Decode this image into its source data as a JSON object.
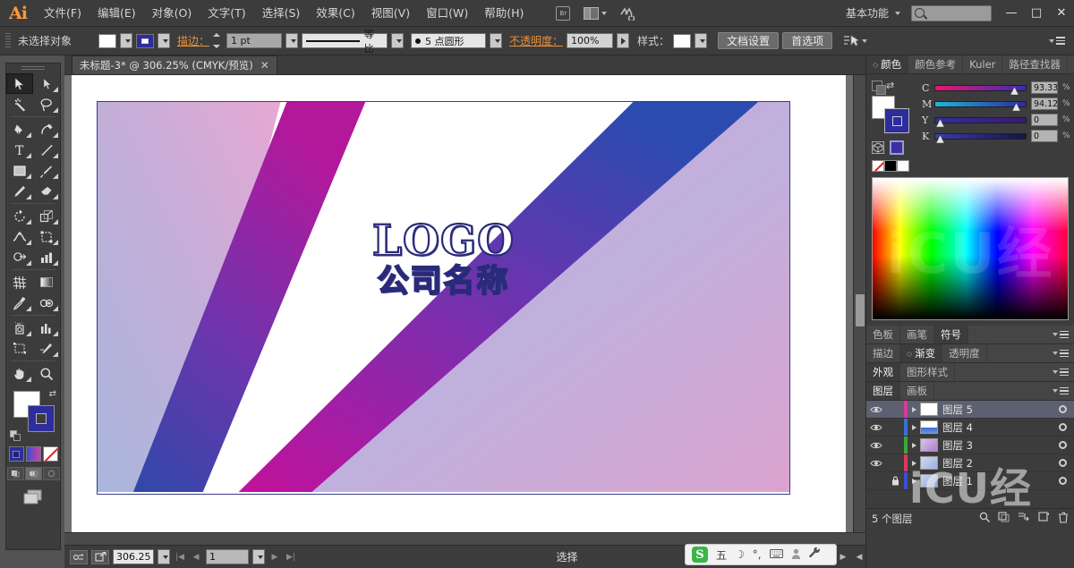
{
  "app": {
    "name": "Ai",
    "logo_color": "#ff9a3c"
  },
  "menubar": {
    "items": [
      {
        "label": "文件(F)"
      },
      {
        "label": "编辑(E)"
      },
      {
        "label": "对象(O)"
      },
      {
        "label": "文字(T)"
      },
      {
        "label": "选择(S)"
      },
      {
        "label": "效果(C)"
      },
      {
        "label": "视图(V)"
      },
      {
        "label": "窗口(W)"
      },
      {
        "label": "帮助(H)"
      }
    ],
    "bridge_label": "Br",
    "workspace": "基本功能",
    "search_placeholder": "",
    "window_buttons": {
      "minimize": "—",
      "maximize": "□",
      "close": "✕"
    }
  },
  "controlbar": {
    "selection_status": "未选择对象",
    "stroke_label": "描边：",
    "stroke_weight": "1 pt",
    "profile_label": "等比",
    "brush_label": "5 点圆形",
    "opacity_label": "不透明度：",
    "opacity_value": "100%",
    "style_label": "样式：",
    "doc_setup_button": "文档设置",
    "preferences_button": "首选项"
  },
  "document": {
    "tab_title": "未标题-3* @ 306.25% (CMYK/预览)",
    "close_label": "✕"
  },
  "artwork": {
    "logo_text": "LOGO",
    "company_text": "公司名称",
    "logo_color": "#2a2a7a",
    "border_color": "#3a3a8a",
    "gradient_light_start": "#a9b6dd",
    "gradient_light_end": "#e7a8d4",
    "stripe_top": "#b3189b",
    "stripe_bottom": "#2f49a8",
    "stripe_right_top": "#2b4bb0",
    "stripe_right_bottom": "#c2119b"
  },
  "statusbar": {
    "zoom_level": "306.25",
    "artboard_number": "1",
    "status_text": "选择"
  },
  "color_panel": {
    "tabs": [
      {
        "label": "颜色",
        "active": true
      },
      {
        "label": "颜色参考",
        "active": false
      },
      {
        "label": "Kuler",
        "active": false
      },
      {
        "label": "路径查找器",
        "active": false
      }
    ],
    "channels": [
      {
        "label": "C",
        "value": "93.33",
        "unit": "%",
        "pos": 83,
        "track": "linear-gradient(90deg,#e8186e,#3a2bb8)"
      },
      {
        "label": "M",
        "value": "94.12",
        "unit": "%",
        "pos": 85,
        "track": "linear-gradient(90deg,#1fb5d8,#2b2b9e)"
      },
      {
        "label": "Y",
        "value": "0",
        "unit": "%",
        "pos": 2,
        "track": "linear-gradient(90deg,#2f2f9e,#3a1a6e)"
      },
      {
        "label": "K",
        "value": "0",
        "unit": "%",
        "pos": 2,
        "track": "linear-gradient(90deg,#3b3bb0,#151540)"
      }
    ],
    "spectrum_watermark": "iCU经"
  },
  "dock_tab_rows": [
    {
      "tabs": [
        {
          "label": "色板",
          "active": false
        },
        {
          "label": "画笔",
          "active": false
        },
        {
          "label": "符号",
          "active": true
        }
      ]
    },
    {
      "tabs": [
        {
          "label": "描边",
          "active": false
        },
        {
          "label": "渐变",
          "active": true
        },
        {
          "label": "透明度",
          "active": false
        }
      ]
    },
    {
      "tabs": [
        {
          "label": "外观",
          "active": true
        },
        {
          "label": "图形样式",
          "active": false
        }
      ]
    },
    {
      "tabs": [
        {
          "label": "图层",
          "active": true
        },
        {
          "label": "画板",
          "active": false
        }
      ]
    }
  ],
  "layers_panel": {
    "rows": [
      {
        "name": "图层 5",
        "color": "#e0359c",
        "visible": true,
        "locked": false,
        "selected": true,
        "thumb": "#ffffff"
      },
      {
        "name": "图层 4",
        "color": "#3b6fd4",
        "visible": true,
        "locked": false,
        "selected": false,
        "thumb": "#eef2fb"
      },
      {
        "name": "图层 3",
        "color": "#3aa83a",
        "visible": true,
        "locked": false,
        "selected": false,
        "thumb": "#d7c3e8"
      },
      {
        "name": "图层 2",
        "color": "#d43b5e",
        "visible": true,
        "locked": false,
        "selected": false,
        "thumb": "#cfd8ee"
      },
      {
        "name": "图层 1",
        "color": "#3b4fd4",
        "visible": false,
        "locked": true,
        "selected": false,
        "thumb": "#c9d4ec"
      }
    ],
    "count_label": "5 个图层",
    "watermark": "iCU经"
  },
  "toolbox": {
    "tools": [
      {
        "name": "selection-tool",
        "active": true
      },
      {
        "name": "direct-selection-tool",
        "active": false
      },
      {
        "name": "magic-wand-tool",
        "active": false
      },
      {
        "name": "lasso-tool",
        "active": false
      },
      {
        "name": "pen-tool",
        "active": false
      },
      {
        "name": "curvature-tool",
        "active": false
      },
      {
        "name": "type-tool",
        "active": false
      },
      {
        "name": "line-segment-tool",
        "active": false
      },
      {
        "name": "rectangle-tool",
        "active": false
      },
      {
        "name": "paintbrush-tool",
        "active": false
      },
      {
        "name": "pencil-tool",
        "active": false
      },
      {
        "name": "eraser-tool",
        "active": false
      },
      {
        "name": "rotate-tool",
        "active": false
      },
      {
        "name": "scale-tool",
        "active": false
      },
      {
        "name": "width-tool",
        "active": false
      },
      {
        "name": "free-transform-tool",
        "active": false
      },
      {
        "name": "shape-builder-tool",
        "active": false
      },
      {
        "name": "column-graph-tool",
        "active": false
      },
      {
        "name": "mesh-tool",
        "active": false
      },
      {
        "name": "gradient-tool",
        "active": false
      },
      {
        "name": "eyedropper-tool",
        "active": false
      },
      {
        "name": "blend-tool",
        "active": false
      },
      {
        "name": "symbol-sprayer-tool",
        "active": false
      },
      {
        "name": "graph-tool",
        "active": false
      },
      {
        "name": "artboard-tool",
        "active": false
      },
      {
        "name": "slice-tool",
        "active": false
      },
      {
        "name": "hand-tool",
        "active": false
      },
      {
        "name": "zoom-tool",
        "active": false
      }
    ]
  },
  "ime": {
    "logo": "S",
    "items": [
      "五",
      "☽",
      "°,",
      "⌨",
      "👤",
      "🔧"
    ]
  }
}
